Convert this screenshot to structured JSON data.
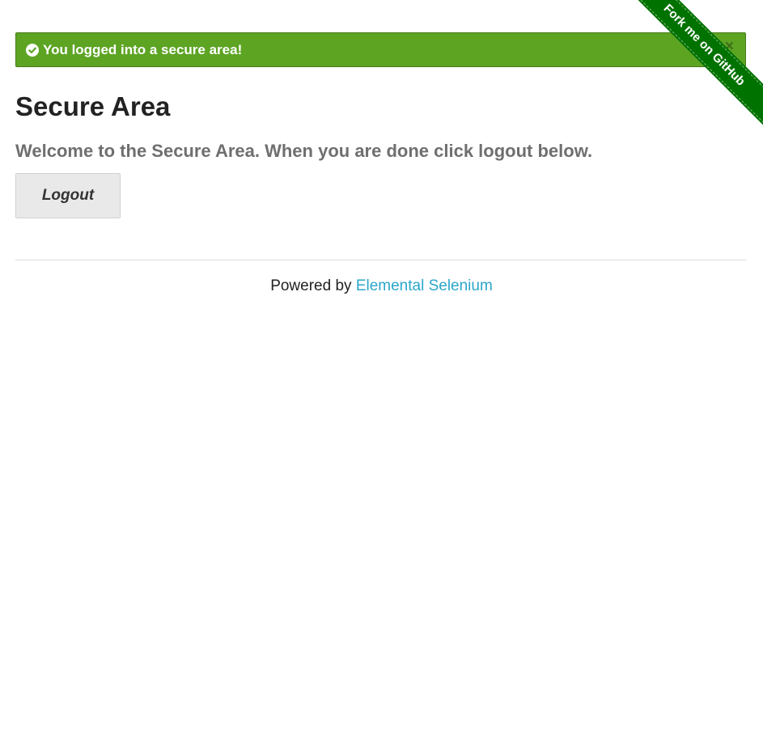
{
  "flash": {
    "message": "You logged into a secure area!",
    "close": "×"
  },
  "header": {
    "title": "Secure Area",
    "subheader": "Welcome to the Secure Area. When you are done click logout below."
  },
  "actions": {
    "logout_label": "Logout"
  },
  "footer": {
    "prefix": "Powered by ",
    "link_label": "Elemental Selenium"
  },
  "ribbon": {
    "label": "Fork me on GitHub"
  },
  "colors": {
    "flash_bg": "#5da423",
    "ribbon_bg": "#007200",
    "link": "#2ba6cb"
  }
}
